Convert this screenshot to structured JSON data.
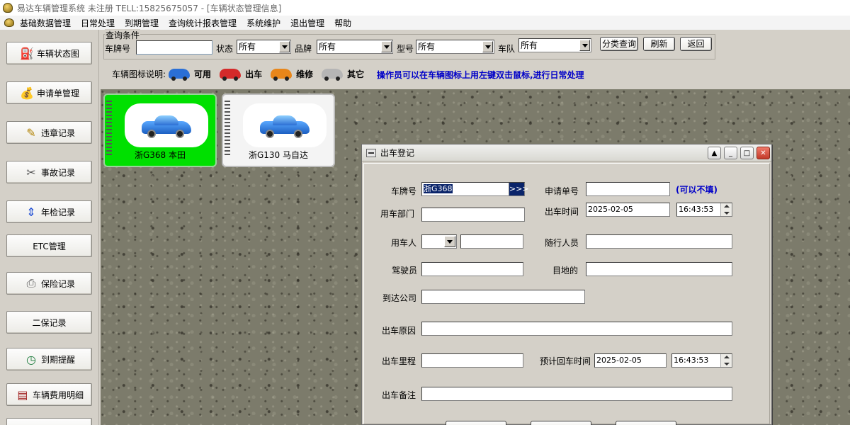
{
  "window": {
    "title": "易达车辆管理系统 未注册 TELL:15825675057 - [车辆状态管理信息]"
  },
  "menu": [
    "基础数据管理",
    "日常处理",
    "到期管理",
    "查询统计报表管理",
    "系统维护",
    "退出管理",
    "帮助"
  ],
  "sidebar": [
    {
      "label": "车辆状态图",
      "icon": "car-status-icon"
    },
    {
      "label": "申请单管理",
      "icon": "money-bag-icon"
    },
    {
      "label": "违章记录",
      "icon": "violation-icon"
    },
    {
      "label": "事故记录",
      "icon": "accident-icon"
    },
    {
      "label": "年检记录",
      "icon": "annual-check-icon"
    },
    {
      "label": "ETC管理",
      "icon": ""
    },
    {
      "label": "保险记录",
      "icon": "printer-icon"
    },
    {
      "label": "二保记录",
      "icon": ""
    },
    {
      "label": "到期提醒",
      "icon": "clock-icon"
    },
    {
      "label": "车辆费用明细",
      "icon": "expense-icon"
    }
  ],
  "query": {
    "group_title": "查询条件",
    "plate_label": "车牌号",
    "plate_value": "",
    "status_label": "状态",
    "status_value": "所有",
    "brand_label": "品牌",
    "brand_value": "所有",
    "model_label": "型号",
    "model_value": "所有",
    "team_label": "车队",
    "team_value": "所有",
    "search_btn": "分类查询",
    "refresh_btn": "刷新",
    "back_btn": "返回"
  },
  "legend": {
    "title": "车辆图标说明:",
    "items": [
      {
        "label": "可用",
        "color": "#2a6fd6"
      },
      {
        "label": "出车",
        "color": "#d42a2a"
      },
      {
        "label": "维修",
        "color": "#e8861a"
      },
      {
        "label": "其它",
        "color": "#b5b5b5"
      }
    ],
    "hint": "操作员可以在车辆图标上用左键双击鼠标,进行日常处理"
  },
  "cars": [
    {
      "label": "浙G368  本田",
      "bg": "#00e000"
    },
    {
      "label": "浙G130  马自达",
      "bg": "#f4f4f4"
    }
  ],
  "dialog": {
    "title": "出车登记",
    "plate_label": "车牌号",
    "plate_value": "浙G368",
    "plate_more": ">>>",
    "app_no_label": "申请单号",
    "app_no_value": "",
    "app_note": "(可以不填)",
    "dept_label": "用车部门",
    "dept_value": "",
    "out_time_label": "出车时间",
    "out_date": "2025-02-05",
    "out_time": "16:43:53",
    "user_label": "用车人",
    "user_value": "",
    "companion_label": "随行人员",
    "companion_value": "",
    "driver_label": "驾驶员",
    "driver_value": "",
    "dest_label": "目地的",
    "dest_value": "",
    "arrive_label": "到达公司",
    "arrive_value": "",
    "reason_label": "出车原因",
    "reason_value": "",
    "mileage_label": "出车里程",
    "mileage_value": "",
    "return_label": "预计回车时间",
    "return_date": "2025-02-05",
    "return_time": "16:43:53",
    "remark_label": "出车备注",
    "remark_value": ""
  },
  "colors": {
    "available": "#2a6fd6",
    "out": "#d42a2a",
    "repair": "#e8861a",
    "other": "#b5b5b5",
    "hint": "#0000c8",
    "selected_card": "#00e000"
  }
}
